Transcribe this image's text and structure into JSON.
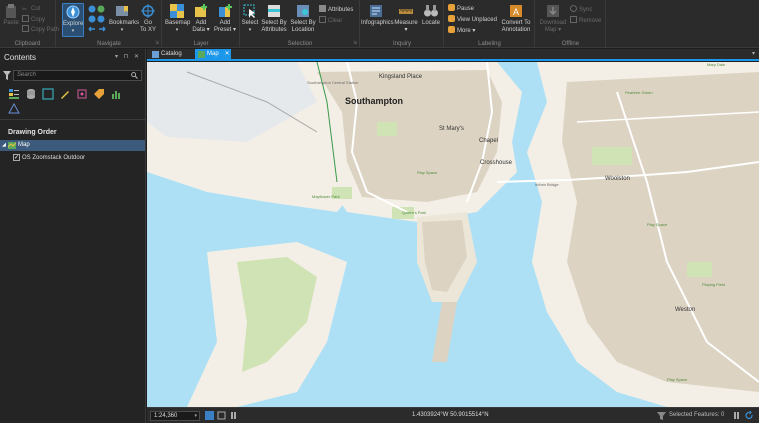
{
  "ribbon": {
    "groups": {
      "clipboard": "Clipboard",
      "navigate": "Navigate",
      "layer": "Layer",
      "selection": "Selection",
      "inquiry": "Inquiry",
      "labeling": "Labeling",
      "offline": "Offline"
    },
    "buttons": {
      "paste": "Paste",
      "cut": "Cut",
      "copy": "Copy",
      "copy_path": "Copy Path",
      "explore": "Explore",
      "bookmarks": "Bookmarks",
      "go_to_xy_1": "Go",
      "go_to_xy_2": "To XY",
      "basemap": "Basemap",
      "add_data_1": "Add",
      "add_data_2": "Data",
      "add_preset_1": "Add",
      "add_preset_2": "Preset",
      "select": "Select",
      "select_by_attributes_1": "Select By",
      "select_by_attributes_2": "Attributes",
      "select_by_location_1": "Select By",
      "select_by_location_2": "Location",
      "attributes": "Attributes",
      "clear": "Clear",
      "infographics": "Infographics",
      "measure": "Measure",
      "locate": "Locate",
      "pause": "Pause",
      "view_unplaced": "View Unplaced",
      "more": "More",
      "convert_to_annotation_1": "Convert To",
      "convert_to_annotation_2": "Annotation",
      "download_map_1": "Download",
      "download_map_2": "Map",
      "sync": "Sync",
      "remove": "Remove"
    }
  },
  "contents": {
    "title": "Contents",
    "pane_controls": "▾ ⊓ ✕",
    "search_placeholder": "Search",
    "drawing_order_title": "Drawing Order",
    "map_item": "Map",
    "layer_item": "OS Zoomstack Outdoor"
  },
  "tabs": {
    "catalog": "Catalog",
    "map": "Map",
    "close": "✕",
    "more": "▾"
  },
  "map_labels": {
    "city": "Southampton",
    "kingsland": "Kingsland Place",
    "stmarys": "St Mary's",
    "chapel": "Chapel",
    "crosshouse": "Crosshouse",
    "woolston": "Woolston",
    "weston": "Weston",
    "central_station": "Southampton Central Station",
    "mayflower": "Mayflower Park",
    "queens_park": "Queen's Park",
    "play_space": "Play Space",
    "playing_field": "Playing Field",
    "itchen_bridge": "Itchen Bridge",
    "mary_dale": "Mary Dale",
    "peartree_green": "Peartree Green"
  },
  "status": {
    "scale": "1:24,360",
    "coords": "1.4303924°W 50.9015514°N",
    "selected_features": "Selected Features: 0"
  },
  "colors": {
    "accent": "#1c97ea",
    "water": "#aee0f5",
    "land": "#f3efe6",
    "urban": "#dcd3c2",
    "park": "#cfe3b5"
  }
}
